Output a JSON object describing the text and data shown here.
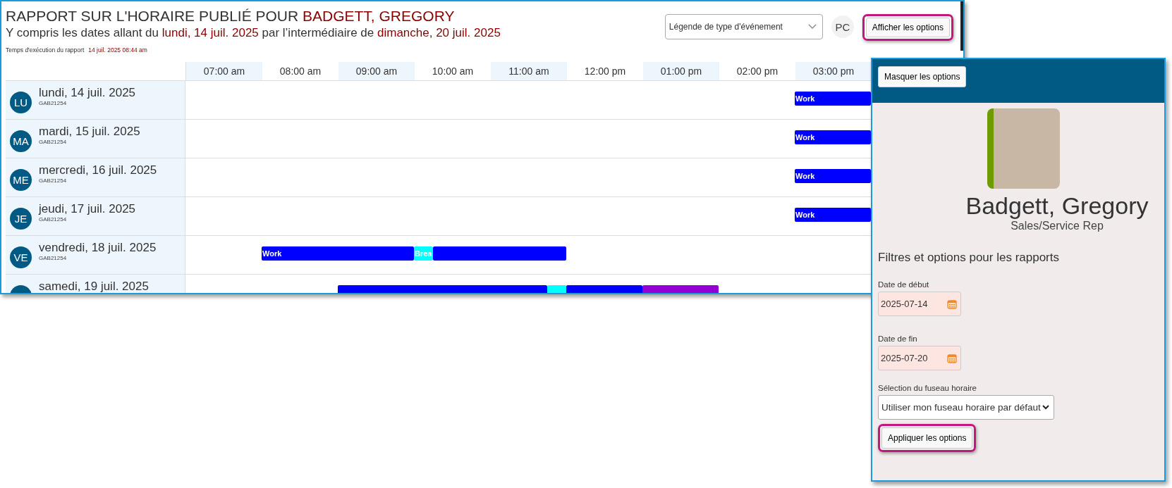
{
  "report": {
    "title": "RAPPORT SUR L'HORAIRE PUBLIÉ POUR",
    "employee": "BADGETT, GREGORY",
    "range_prefix": "Y compris les dates allant du",
    "range_start": "lundi, 14 juil. 2025",
    "range_middle": "par l’intermédiaire de",
    "range_end": "dimanche, 20 juil. 2025",
    "run_label": "Temps d'exécution du rapport",
    "run_time": "14 juil. 2025 08:44 am"
  },
  "legend_dropdown": {
    "placeholder": "Légende de type d'événement"
  },
  "user_badge": "PC",
  "show_options_button": {
    "label": "Afficher les options",
    "highlighted": true
  },
  "hours": [
    "07:00 am",
    "08:00 am",
    "09:00 am",
    "10:00 am",
    "11:00 am",
    "12:00 pm",
    "01:00 pm",
    "02:00 pm",
    "03:00 pm"
  ],
  "days": [
    {
      "initials": "LU",
      "date": "lundi, 14 juil. 2025",
      "code": "GAB21254",
      "quarter_slots": [
        {
          "kind": "none"
        },
        {
          "kind": "none"
        },
        {
          "kind": "none"
        },
        {
          "kind": "none"
        },
        {
          "kind": "none"
        },
        {
          "kind": "none"
        },
        {
          "kind": "none"
        },
        {
          "kind": "none"
        },
        {
          "kind": "none"
        },
        {
          "kind": "none"
        },
        {
          "kind": "none"
        },
        {
          "kind": "none"
        },
        {
          "kind": "none"
        },
        {
          "kind": "none"
        },
        {
          "kind": "none"
        },
        {
          "kind": "none"
        },
        {
          "kind": "none"
        },
        {
          "kind": "none"
        },
        {
          "kind": "none"
        },
        {
          "kind": "none"
        },
        {
          "kind": "none"
        },
        {
          "kind": "none"
        },
        {
          "kind": "none"
        },
        {
          "kind": "none"
        },
        {
          "kind": "none"
        },
        {
          "kind": "none"
        },
        {
          "kind": "none"
        },
        {
          "kind": "none"
        },
        {
          "kind": "none"
        },
        {
          "kind": "none"
        },
        {
          "kind": "none"
        },
        {
          "kind": "none"
        },
        {
          "kind": "work",
          "label": "Work"
        },
        {
          "kind": "work"
        },
        {
          "kind": "work"
        },
        {
          "kind": "work"
        }
      ]
    },
    {
      "initials": "MA",
      "date": "mardi, 15 juil. 2025",
      "code": "GAB21254",
      "quarter_slots": [
        {
          "kind": "none"
        },
        {
          "kind": "none"
        },
        {
          "kind": "none"
        },
        {
          "kind": "none"
        },
        {
          "kind": "none"
        },
        {
          "kind": "none"
        },
        {
          "kind": "none"
        },
        {
          "kind": "none"
        },
        {
          "kind": "none"
        },
        {
          "kind": "none"
        },
        {
          "kind": "none"
        },
        {
          "kind": "none"
        },
        {
          "kind": "none"
        },
        {
          "kind": "none"
        },
        {
          "kind": "none"
        },
        {
          "kind": "none"
        },
        {
          "kind": "none"
        },
        {
          "kind": "none"
        },
        {
          "kind": "none"
        },
        {
          "kind": "none"
        },
        {
          "kind": "none"
        },
        {
          "kind": "none"
        },
        {
          "kind": "none"
        },
        {
          "kind": "none"
        },
        {
          "kind": "none"
        },
        {
          "kind": "none"
        },
        {
          "kind": "none"
        },
        {
          "kind": "none"
        },
        {
          "kind": "none"
        },
        {
          "kind": "none"
        },
        {
          "kind": "none"
        },
        {
          "kind": "none"
        },
        {
          "kind": "work",
          "label": "Work"
        },
        {
          "kind": "work"
        },
        {
          "kind": "work"
        },
        {
          "kind": "work"
        }
      ]
    },
    {
      "initials": "ME",
      "date": "mercredi, 16 juil. 2025",
      "code": "GAB21254",
      "quarter_slots": [
        {
          "kind": "none"
        },
        {
          "kind": "none"
        },
        {
          "kind": "none"
        },
        {
          "kind": "none"
        },
        {
          "kind": "none"
        },
        {
          "kind": "none"
        },
        {
          "kind": "none"
        },
        {
          "kind": "none"
        },
        {
          "kind": "none"
        },
        {
          "kind": "none"
        },
        {
          "kind": "none"
        },
        {
          "kind": "none"
        },
        {
          "kind": "none"
        },
        {
          "kind": "none"
        },
        {
          "kind": "none"
        },
        {
          "kind": "none"
        },
        {
          "kind": "none"
        },
        {
          "kind": "none"
        },
        {
          "kind": "none"
        },
        {
          "kind": "none"
        },
        {
          "kind": "none"
        },
        {
          "kind": "none"
        },
        {
          "kind": "none"
        },
        {
          "kind": "none"
        },
        {
          "kind": "none"
        },
        {
          "kind": "none"
        },
        {
          "kind": "none"
        },
        {
          "kind": "none"
        },
        {
          "kind": "none"
        },
        {
          "kind": "none"
        },
        {
          "kind": "none"
        },
        {
          "kind": "none"
        },
        {
          "kind": "work",
          "label": "Work"
        },
        {
          "kind": "work"
        },
        {
          "kind": "work"
        },
        {
          "kind": "work"
        }
      ]
    },
    {
      "initials": "JE",
      "date": "jeudi, 17 juil. 2025",
      "code": "GAB21254",
      "quarter_slots": [
        {
          "kind": "none"
        },
        {
          "kind": "none"
        },
        {
          "kind": "none"
        },
        {
          "kind": "none"
        },
        {
          "kind": "none"
        },
        {
          "kind": "none"
        },
        {
          "kind": "none"
        },
        {
          "kind": "none"
        },
        {
          "kind": "none"
        },
        {
          "kind": "none"
        },
        {
          "kind": "none"
        },
        {
          "kind": "none"
        },
        {
          "kind": "none"
        },
        {
          "kind": "none"
        },
        {
          "kind": "none"
        },
        {
          "kind": "none"
        },
        {
          "kind": "none"
        },
        {
          "kind": "none"
        },
        {
          "kind": "none"
        },
        {
          "kind": "none"
        },
        {
          "kind": "none"
        },
        {
          "kind": "none"
        },
        {
          "kind": "none"
        },
        {
          "kind": "none"
        },
        {
          "kind": "none"
        },
        {
          "kind": "none"
        },
        {
          "kind": "none"
        },
        {
          "kind": "none"
        },
        {
          "kind": "none"
        },
        {
          "kind": "none"
        },
        {
          "kind": "none"
        },
        {
          "kind": "none"
        },
        {
          "kind": "work",
          "label": "Work"
        },
        {
          "kind": "work"
        },
        {
          "kind": "work"
        },
        {
          "kind": "work"
        }
      ]
    },
    {
      "initials": "VE",
      "date": "vendredi, 18 juil. 2025",
      "code": "GAB21254",
      "quarter_slots": [
        {
          "kind": "none"
        },
        {
          "kind": "none"
        },
        {
          "kind": "none"
        },
        {
          "kind": "none"
        },
        {
          "kind": "work",
          "label": "Work"
        },
        {
          "kind": "work"
        },
        {
          "kind": "work"
        },
        {
          "kind": "work"
        },
        {
          "kind": "work"
        },
        {
          "kind": "work"
        },
        {
          "kind": "work"
        },
        {
          "kind": "work"
        },
        {
          "kind": "break",
          "label": "Brea"
        },
        {
          "kind": "work"
        },
        {
          "kind": "work"
        },
        {
          "kind": "work"
        },
        {
          "kind": "work"
        },
        {
          "kind": "work"
        },
        {
          "kind": "work"
        },
        {
          "kind": "work"
        },
        {
          "kind": "none"
        },
        {
          "kind": "none"
        },
        {
          "kind": "none"
        },
        {
          "kind": "none"
        },
        {
          "kind": "none"
        },
        {
          "kind": "none"
        },
        {
          "kind": "none"
        },
        {
          "kind": "none"
        },
        {
          "kind": "none"
        },
        {
          "kind": "none"
        },
        {
          "kind": "none"
        },
        {
          "kind": "none"
        },
        {
          "kind": "none"
        },
        {
          "kind": "none"
        },
        {
          "kind": "none"
        },
        {
          "kind": "none"
        }
      ]
    },
    {
      "date": "samedi, 19 juil. 2025",
      "quarter_slots": [
        {
          "kind": "none"
        },
        {
          "kind": "none"
        },
        {
          "kind": "none"
        },
        {
          "kind": "none"
        },
        {
          "kind": "none"
        },
        {
          "kind": "none"
        },
        {
          "kind": "none"
        },
        {
          "kind": "none"
        },
        {
          "kind": "work"
        },
        {
          "kind": "work"
        },
        {
          "kind": "work"
        },
        {
          "kind": "work"
        },
        {
          "kind": "work"
        },
        {
          "kind": "work"
        },
        {
          "kind": "work"
        },
        {
          "kind": "work"
        },
        {
          "kind": "work"
        },
        {
          "kind": "work"
        },
        {
          "kind": "work"
        },
        {
          "kind": "break"
        },
        {
          "kind": "work"
        },
        {
          "kind": "work"
        },
        {
          "kind": "work"
        },
        {
          "kind": "work"
        },
        {
          "kind": "other"
        },
        {
          "kind": "other"
        },
        {
          "kind": "other"
        },
        {
          "kind": "other"
        },
        {
          "kind": "none"
        },
        {
          "kind": "none"
        },
        {
          "kind": "none"
        },
        {
          "kind": "none"
        },
        {
          "kind": "none"
        },
        {
          "kind": "none"
        },
        {
          "kind": "none"
        },
        {
          "kind": "none"
        }
      ]
    }
  ],
  "options_panel": {
    "hide_button": "Masquer les options",
    "name": "Badgett, Gregory",
    "role": "Sales/Service Rep",
    "section_title": "Filtres et options pour les rapports",
    "start_label": "Date de début",
    "start_value": "2025-07-14",
    "end_label": "Date de fin",
    "end_value": "2025-07-20",
    "timezone_label": "Sélection du fuseau horaire",
    "timezone_value": "Utiliser mon fuseau horaire par défaut",
    "apply_button": {
      "label": "Appliquer les options",
      "highlighted": true
    }
  }
}
